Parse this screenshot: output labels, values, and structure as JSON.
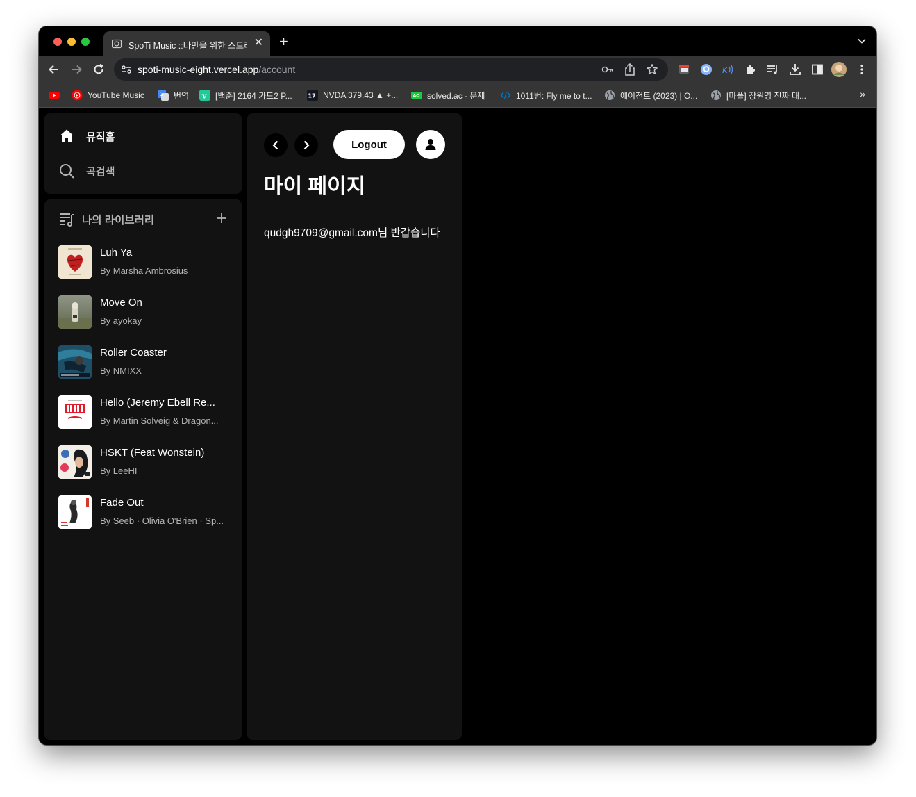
{
  "browser": {
    "tab": {
      "title": "SpoTi Music ::나만을 위한 스트리밍"
    },
    "address": {
      "host": "spoti-music-eight.vercel.app",
      "path": "/account"
    },
    "bookmarks": [
      {
        "icon": "youtube-icon",
        "label": ""
      },
      {
        "icon": "youtube-music-icon",
        "label": "YouTube Music"
      },
      {
        "icon": "google-translate-icon",
        "label": "번역"
      },
      {
        "icon": "velog-icon",
        "label": "[백준] 2164 카드2 P..."
      },
      {
        "icon": "tradingview-icon",
        "label": "NVDA 379.43 ▲ +..."
      },
      {
        "icon": "solved-ac-icon",
        "label": "solved.ac - 문제"
      },
      {
        "icon": "code-icon",
        "label": "1011번: Fly me to t..."
      },
      {
        "icon": "globe-icon",
        "label": "에이전트 (2023) | O..."
      },
      {
        "icon": "globe-icon",
        "label": "[마플] 장원영 진짜 대..."
      }
    ],
    "bookmarks_more": "»"
  },
  "sidebar": {
    "nav": [
      {
        "icon": "home-icon",
        "label": "뮤직홈"
      },
      {
        "icon": "search-icon",
        "label": "곡검색"
      }
    ],
    "library": {
      "title": "나의 라이브러리",
      "songs": [
        {
          "title": "Luh Ya",
          "artist": "By Marsha Ambrosius"
        },
        {
          "title": "Move On",
          "artist": "By ayokay"
        },
        {
          "title": "Roller Coaster",
          "artist": "By NMIXX"
        },
        {
          "title": "Hello (Jeremy Ebell Re...",
          "artist": "By Martin Solveig & Dragon..."
        },
        {
          "title": "HSKT (Feat Wonstein)",
          "artist": "By LeeHI"
        },
        {
          "title": "Fade Out",
          "artist": "By Seeb · Olivia O'Brien · Sp..."
        }
      ]
    }
  },
  "main": {
    "logout_label": "Logout",
    "title": "마이 페이지",
    "welcome": "qudgh9709@gmail.com님 반갑습니다"
  }
}
